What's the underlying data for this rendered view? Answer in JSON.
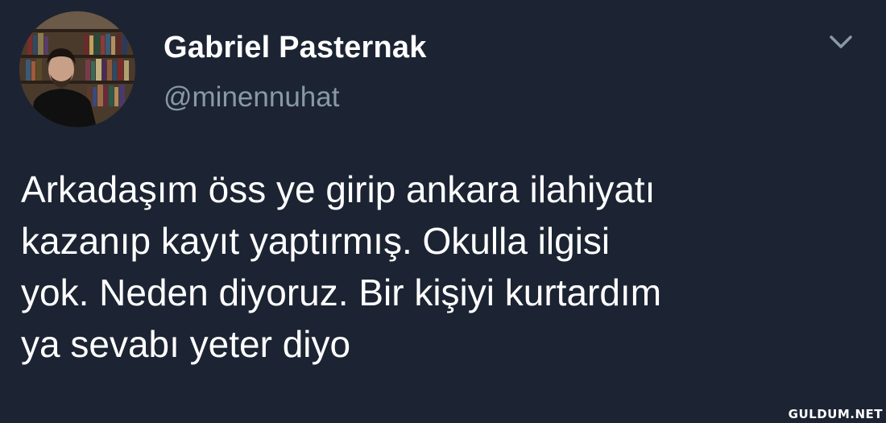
{
  "user": {
    "display_name": "Gabriel Pasternak",
    "handle": "@minennuhat",
    "avatar": "avatar"
  },
  "menu": {
    "icon": "chevron-down-icon"
  },
  "tweet": {
    "text": "Arkadaşım öss ye girip ankara ilahiyatı\nkazanıp kayıt yaptırmış. Okulla ilgisi\nyok. Neden diyoruz. Bir kişiyi kurtardım\nya sevabı yeter diyo"
  },
  "watermark": {
    "text": "GULDUM.NET"
  },
  "colors": {
    "background": "#1c2433",
    "handle": "#8899a6",
    "text": "#ffffff"
  }
}
